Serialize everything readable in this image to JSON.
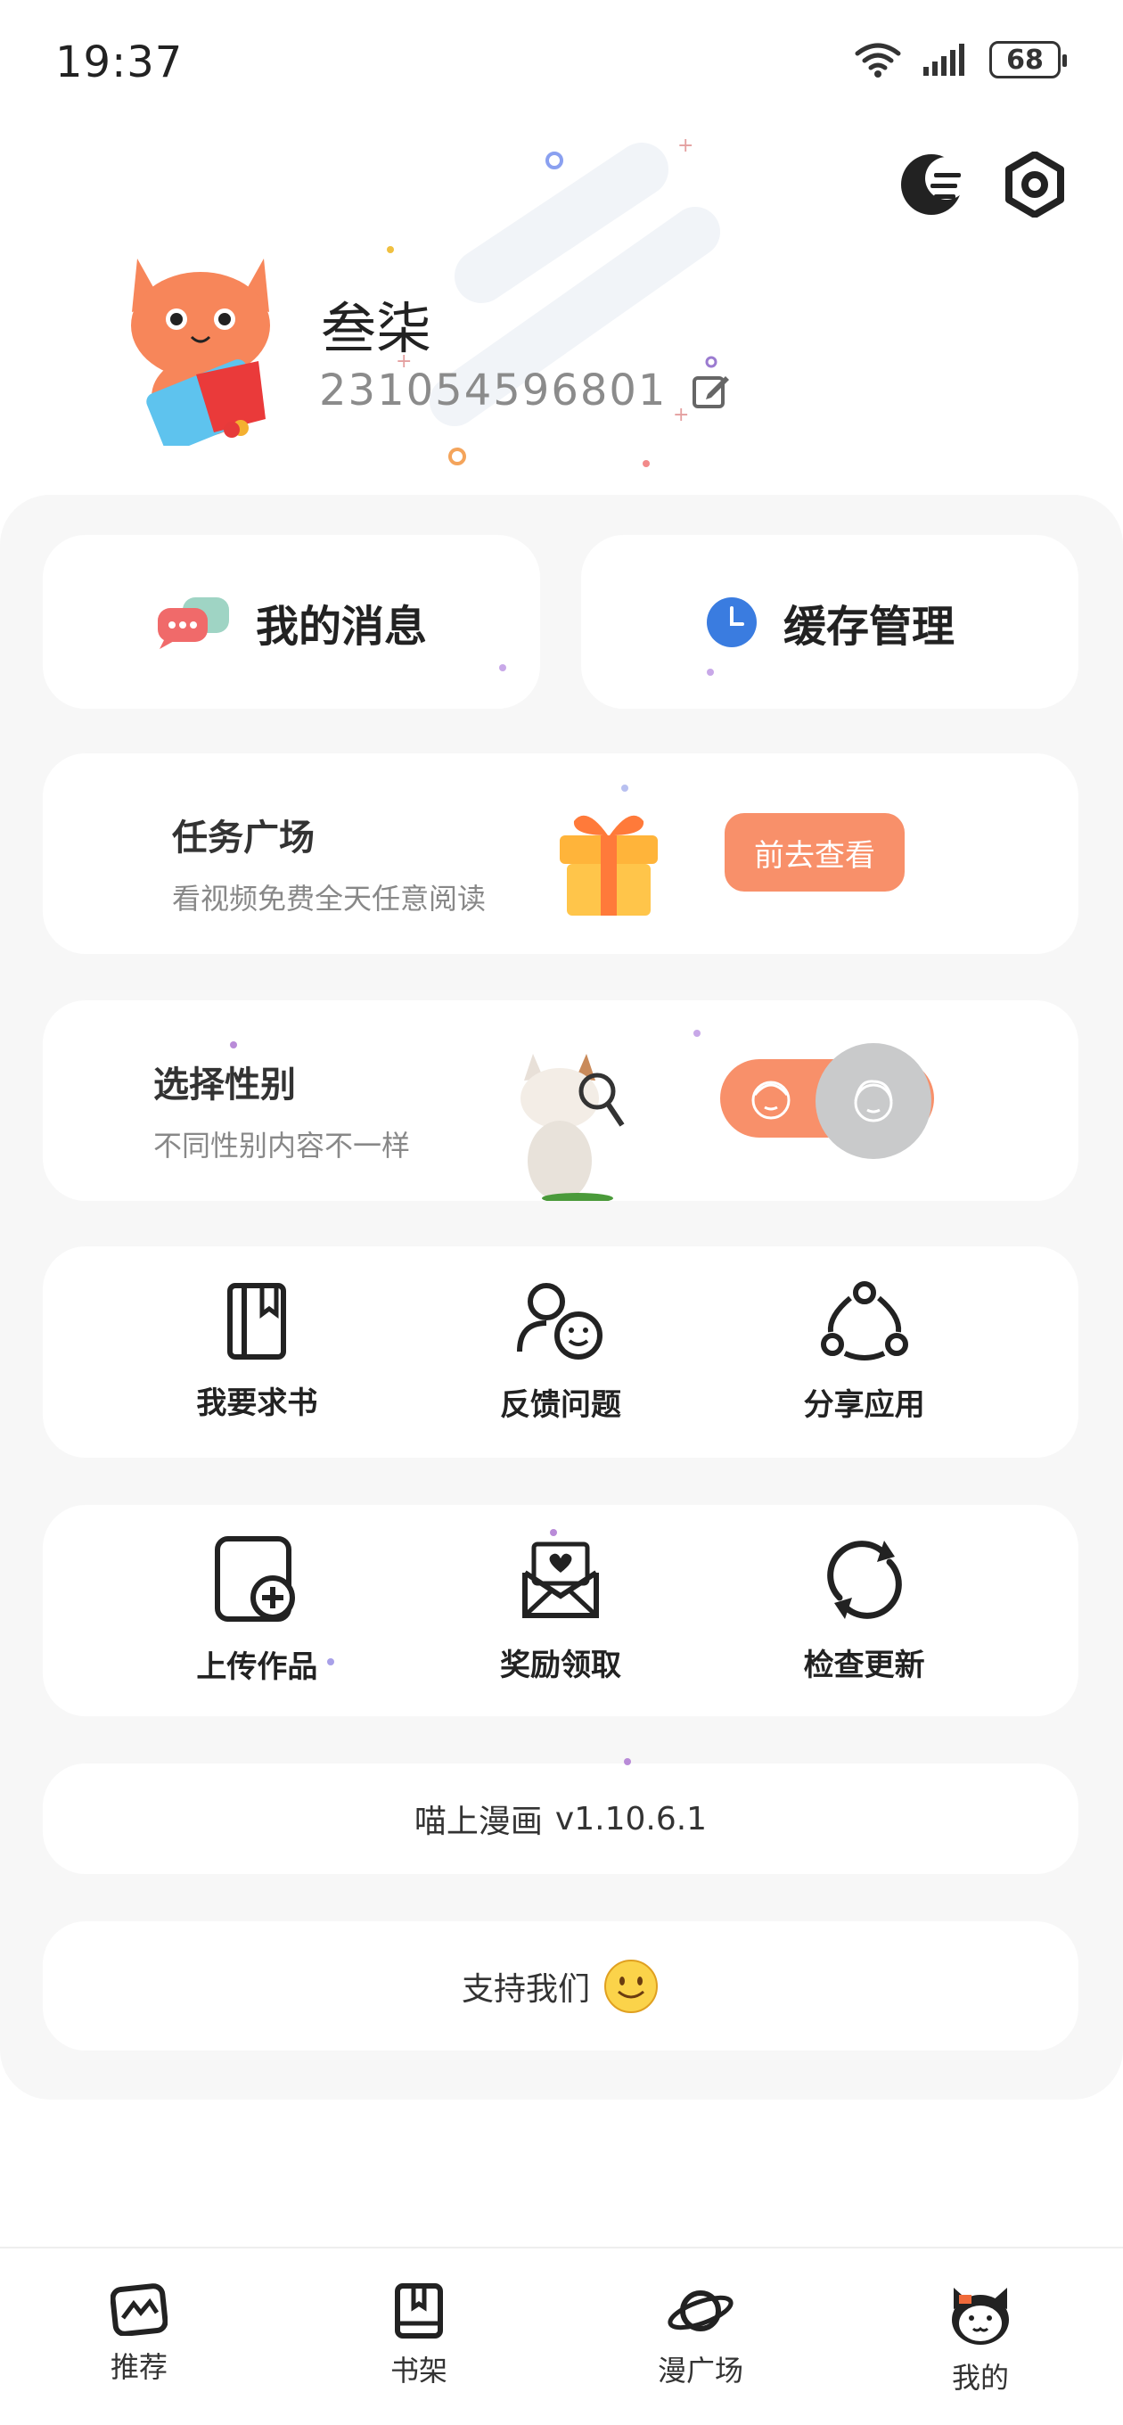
{
  "status": {
    "time": "19:37",
    "battery": "68"
  },
  "profile": {
    "name": "叁柒",
    "id": "231054596801"
  },
  "cards": {
    "messages_label": "我的消息",
    "cache_label": "缓存管理"
  },
  "task": {
    "title": "任务广场",
    "subtitle": "看视频免费全天任意阅读",
    "button": "前去查看"
  },
  "gender": {
    "title": "选择性别",
    "subtitle": "不同性别内容不一样"
  },
  "grid1": [
    {
      "label": "我要求书"
    },
    {
      "label": "反馈问题"
    },
    {
      "label": "分享应用"
    }
  ],
  "grid2": [
    {
      "label": "上传作品"
    },
    {
      "label": "奖励领取"
    },
    {
      "label": "检查更新"
    }
  ],
  "version": {
    "app": "喵上漫画",
    "number": "v1.10.6.1"
  },
  "support": {
    "label": "支持我们"
  },
  "tabs": [
    {
      "label": "推荐"
    },
    {
      "label": "书架"
    },
    {
      "label": "漫广场"
    },
    {
      "label": "我的"
    }
  ],
  "colors": {
    "accent": "#f8906a",
    "panel": "#f7f7f7"
  }
}
